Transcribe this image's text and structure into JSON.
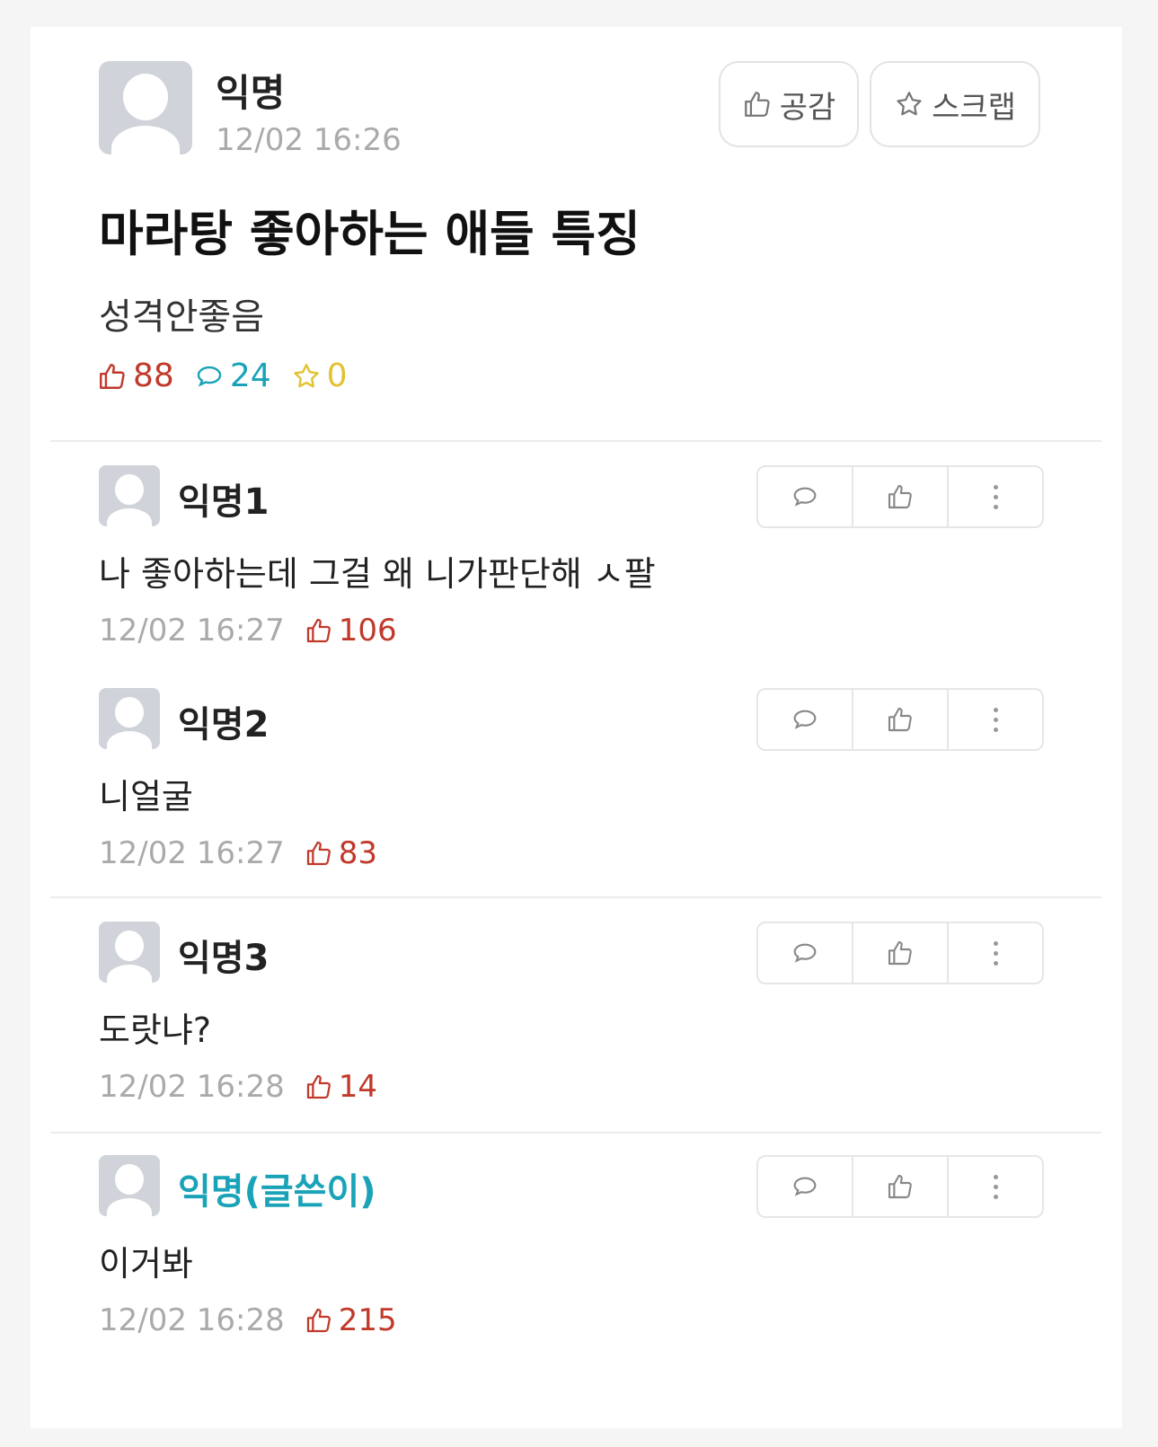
{
  "post": {
    "author": "익명",
    "time": "12/02 16:26",
    "title": "마라탕 좋아하는 애들 특징",
    "body": "성격안좋음",
    "buttons": {
      "like_label": "공감",
      "scrap_label": "스크랩"
    },
    "stats": {
      "likes": "88",
      "comments": "24",
      "scraps": "0"
    }
  },
  "comments": [
    {
      "author": "익명1",
      "text": "나 좋아하는데 그걸 왜 니가판단해 ㅅ팔",
      "time": "12/02 16:27",
      "likes": "106"
    },
    {
      "author": "익명2",
      "text": "니얼굴",
      "time": "12/02 16:27",
      "likes": "83"
    },
    {
      "author": "익명3",
      "text": "도랏냐?",
      "time": "12/02 16:28",
      "likes": "14"
    },
    {
      "author": "익명(글쓴이)",
      "text": "이거봐",
      "time": "12/02 16:28",
      "likes": "215"
    }
  ],
  "colors": {
    "like": "#c0392b",
    "comment": "#1aa3b8",
    "scrap": "#e2c230",
    "op_name": "#1aa3b8"
  },
  "icons": {
    "like": "thumbs-up-icon",
    "comment": "speech-bubble-icon",
    "scrap": "star-icon",
    "more": "kebab-menu-icon"
  }
}
